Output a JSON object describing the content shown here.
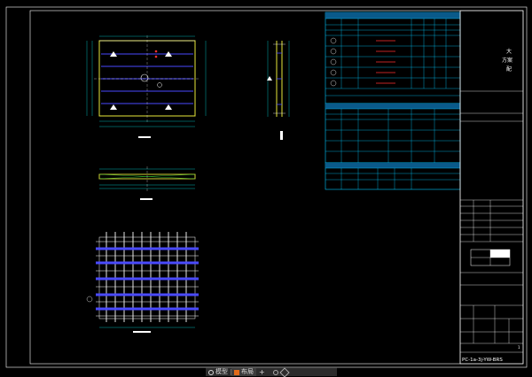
{
  "drawing": {
    "title_vertical": [
      "大",
      "方案",
      "配"
    ],
    "drawing_code": "PC-1a-3j-YW-BRS",
    "sheet_no": "1"
  },
  "status_bar": {
    "tabs": [
      {
        "label": "模型",
        "icon": "model-icon",
        "active": false
      },
      {
        "label": "布局",
        "icon": "layout-icon",
        "active": true
      }
    ],
    "add_label": "+"
  },
  "colors": {
    "frame": "#ffffff",
    "plate": "#e8e83a",
    "rebar": "#4a4aff",
    "dimension": "#00e0e0",
    "table_line": "#00c8ff",
    "table_header": "#0a5a8a",
    "red_mark": "#ff3030",
    "green_line": "#33cc33"
  }
}
